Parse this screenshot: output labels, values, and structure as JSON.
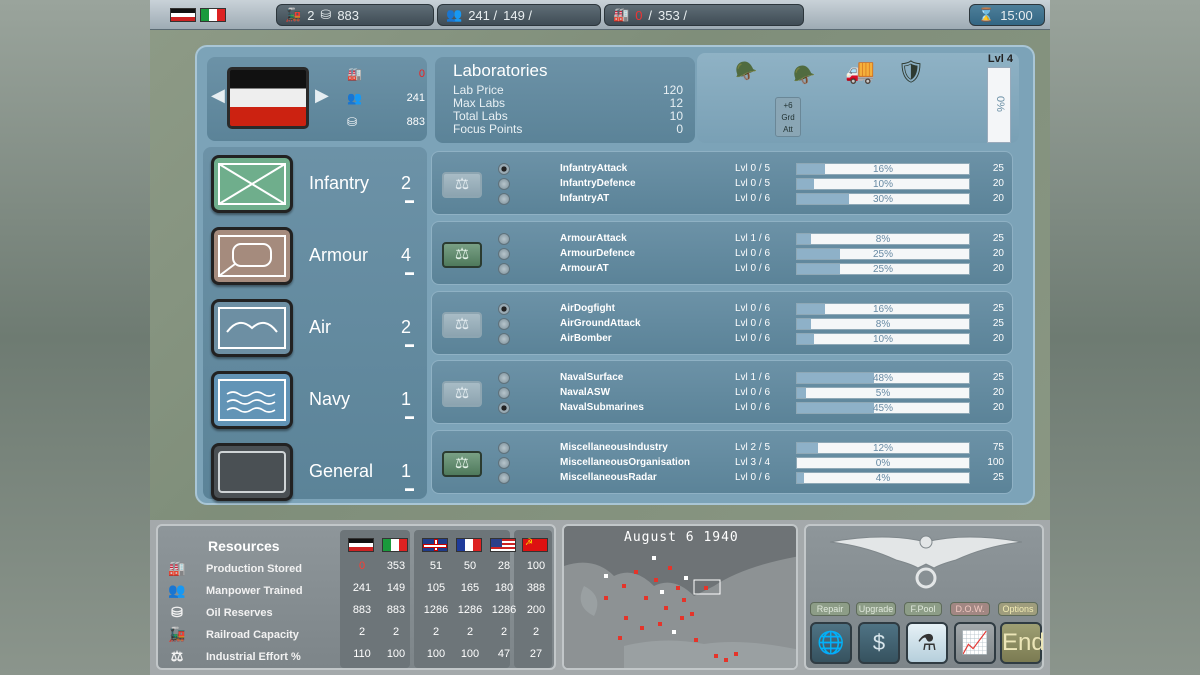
{
  "topbar": {
    "flags": [
      "de",
      "it"
    ],
    "transport_value": "2",
    "oil_value": "883",
    "manpower_value": "241 /",
    "manpower_value2": "149 /",
    "production_value": "0",
    "production_sep": "/",
    "production_value2": "353 /",
    "time": "15:00"
  },
  "nation": {
    "production": "0",
    "manpower": "241",
    "oil": "883"
  },
  "labs": {
    "title": "Laboratories",
    "rows": [
      {
        "label": "Lab Price",
        "value": "120"
      },
      {
        "label": "Max Labs",
        "value": "12"
      },
      {
        "label": "Total Labs",
        "value": "10"
      },
      {
        "label": "Focus Points",
        "value": "0"
      }
    ]
  },
  "units_panel": {
    "level": "Lvl 4",
    "bar_pct": "0%",
    "grd_att": [
      "+6",
      "Grd",
      "Att"
    ]
  },
  "categories": [
    {
      "name": "Infantry",
      "count": "2"
    },
    {
      "name": "Armour",
      "count": "4"
    },
    {
      "name": "Air",
      "count": "2"
    },
    {
      "name": "Navy",
      "count": "1"
    },
    {
      "name": "General",
      "count": "1"
    }
  ],
  "tech_groups": [
    {
      "active": false,
      "techs": [
        {
          "name": "InfantryAttack",
          "lvl": "Lvl 0  /  5",
          "pct": "16%",
          "fill": 16,
          "value": "25",
          "on": true
        },
        {
          "name": "InfantryDefence",
          "lvl": "Lvl 0  /  5",
          "pct": "10%",
          "fill": 10,
          "value": "20",
          "on": false
        },
        {
          "name": "InfantryAT",
          "lvl": "Lvl 0  /  6",
          "pct": "30%",
          "fill": 30,
          "value": "20",
          "on": false
        }
      ]
    },
    {
      "active": true,
      "techs": [
        {
          "name": "ArmourAttack",
          "lvl": "Lvl 1  /  6",
          "pct": "8%",
          "fill": 8,
          "value": "25",
          "on": false
        },
        {
          "name": "ArmourDefence",
          "lvl": "Lvl 0  /  6",
          "pct": "25%",
          "fill": 25,
          "value": "20",
          "on": false
        },
        {
          "name": "ArmourAT",
          "lvl": "Lvl 0  /  6",
          "pct": "25%",
          "fill": 25,
          "value": "20",
          "on": false
        }
      ]
    },
    {
      "active": false,
      "techs": [
        {
          "name": "AirDogfight",
          "lvl": "Lvl 0  /  6",
          "pct": "16%",
          "fill": 16,
          "value": "25",
          "on": true
        },
        {
          "name": "AirGroundAttack",
          "lvl": "Lvl 0  /  6",
          "pct": "8%",
          "fill": 8,
          "value": "25",
          "on": false
        },
        {
          "name": "AirBomber",
          "lvl": "Lvl 0  /  6",
          "pct": "10%",
          "fill": 10,
          "value": "20",
          "on": false
        }
      ]
    },
    {
      "active": false,
      "techs": [
        {
          "name": "NavalSurface",
          "lvl": "Lvl 1  /  6",
          "pct": "48%",
          "fill": 45,
          "value": "25",
          "on": false
        },
        {
          "name": "NavalASW",
          "lvl": "Lvl 0  /  6",
          "pct": "5%",
          "fill": 5,
          "value": "20",
          "on": false
        },
        {
          "name": "NavalSubmarines",
          "lvl": "Lvl 0  /  6",
          "pct": "45%",
          "fill": 45,
          "value": "20",
          "on": true
        }
      ]
    },
    {
      "active": true,
      "techs": [
        {
          "name": "MiscellaneousIndustry",
          "lvl": "Lvl 2  /  5",
          "pct": "12%",
          "fill": 12,
          "value": "75",
          "on": false
        },
        {
          "name": "MiscellaneousOrganisation",
          "lvl": "Lvl 3  /  4",
          "pct": "0%",
          "fill": 0,
          "value": "100",
          "on": false
        },
        {
          "name": "MiscellaneousRadar",
          "lvl": "Lvl 0  /  6",
          "pct": "4%",
          "fill": 4,
          "value": "25",
          "on": false
        }
      ]
    }
  ],
  "resources": {
    "title": "Resources",
    "labels": [
      "Production Stored",
      "Manpower Trained",
      "Oil Reserves",
      "Railroad Capacity",
      "Industrial Effort %"
    ],
    "columns": [
      {
        "flag": "de",
        "values": [
          "0",
          "241",
          "883",
          "2",
          "110"
        ]
      },
      {
        "flag": "it",
        "values": [
          "353",
          "149",
          "883",
          "2",
          "100"
        ]
      },
      {
        "flag": "uk",
        "values": [
          "51",
          "105",
          "1286",
          "2",
          "100"
        ]
      },
      {
        "flag": "fr",
        "values": [
          "50",
          "165",
          "1286",
          "2",
          "100"
        ]
      },
      {
        "flag": "us",
        "values": [
          "28",
          "180",
          "1286",
          "2",
          "47"
        ]
      },
      {
        "flag": "su",
        "values": [
          "100",
          "388",
          "200",
          "2",
          "27"
        ]
      }
    ]
  },
  "minimap": {
    "date": "August 6 1940"
  },
  "controls": {
    "small_buttons": [
      "Repair",
      "Upgrade",
      "F.Pool",
      "D.O.W.",
      "Options"
    ],
    "end_label": "End"
  },
  "colors": {
    "panel": "#7ca3b8",
    "accent_red": "#d11111",
    "active_green": "#4f7a5c"
  }
}
